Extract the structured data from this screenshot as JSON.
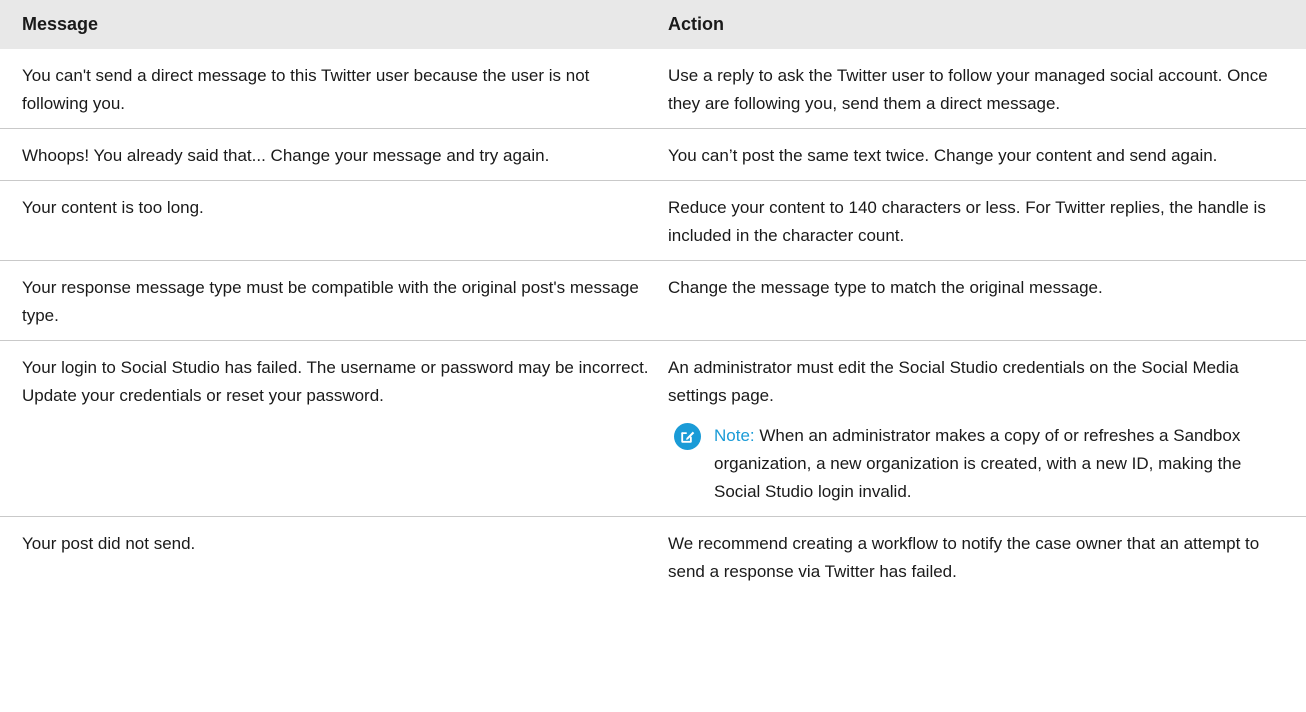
{
  "table": {
    "headers": {
      "message": "Message",
      "action": "Action"
    },
    "rows": [
      {
        "message": "You can't send a direct message to this Twitter user because the user is not following you.",
        "action": "Use a reply to ask the Twitter user to follow your managed social account. Once they are following you, send them a direct message."
      },
      {
        "message": "Whoops! You already said that... Change your message and try again.",
        "action": "You can’t post the same text twice. Change your content and send again."
      },
      {
        "message": "Your content is too long.",
        "action": "Reduce your content to 140 characters or less. For Twitter replies, the handle is included in the character count."
      },
      {
        "message": "Your response message type must be compatible with the original post's message type.",
        "action": "Change the message type to match the original message."
      },
      {
        "message": "Your login to Social Studio has failed. The username or password may be incorrect. Update your credentials or reset your password.",
        "action": "An administrator must edit the Social Studio credentials on the Social Media settings page.",
        "note": {
          "label": "Note:",
          "text": "When an administrator makes a copy of or refreshes a Sandbox organization, a new organization is created, with a new ID, making the Social Studio login invalid.",
          "icon": "edit-note-icon",
          "color": "#1a9bd7"
        }
      },
      {
        "message": "Your post did not send.",
        "action": "We recommend creating a workflow to notify the case owner that an attempt to send a response via Twitter has failed."
      }
    ]
  }
}
